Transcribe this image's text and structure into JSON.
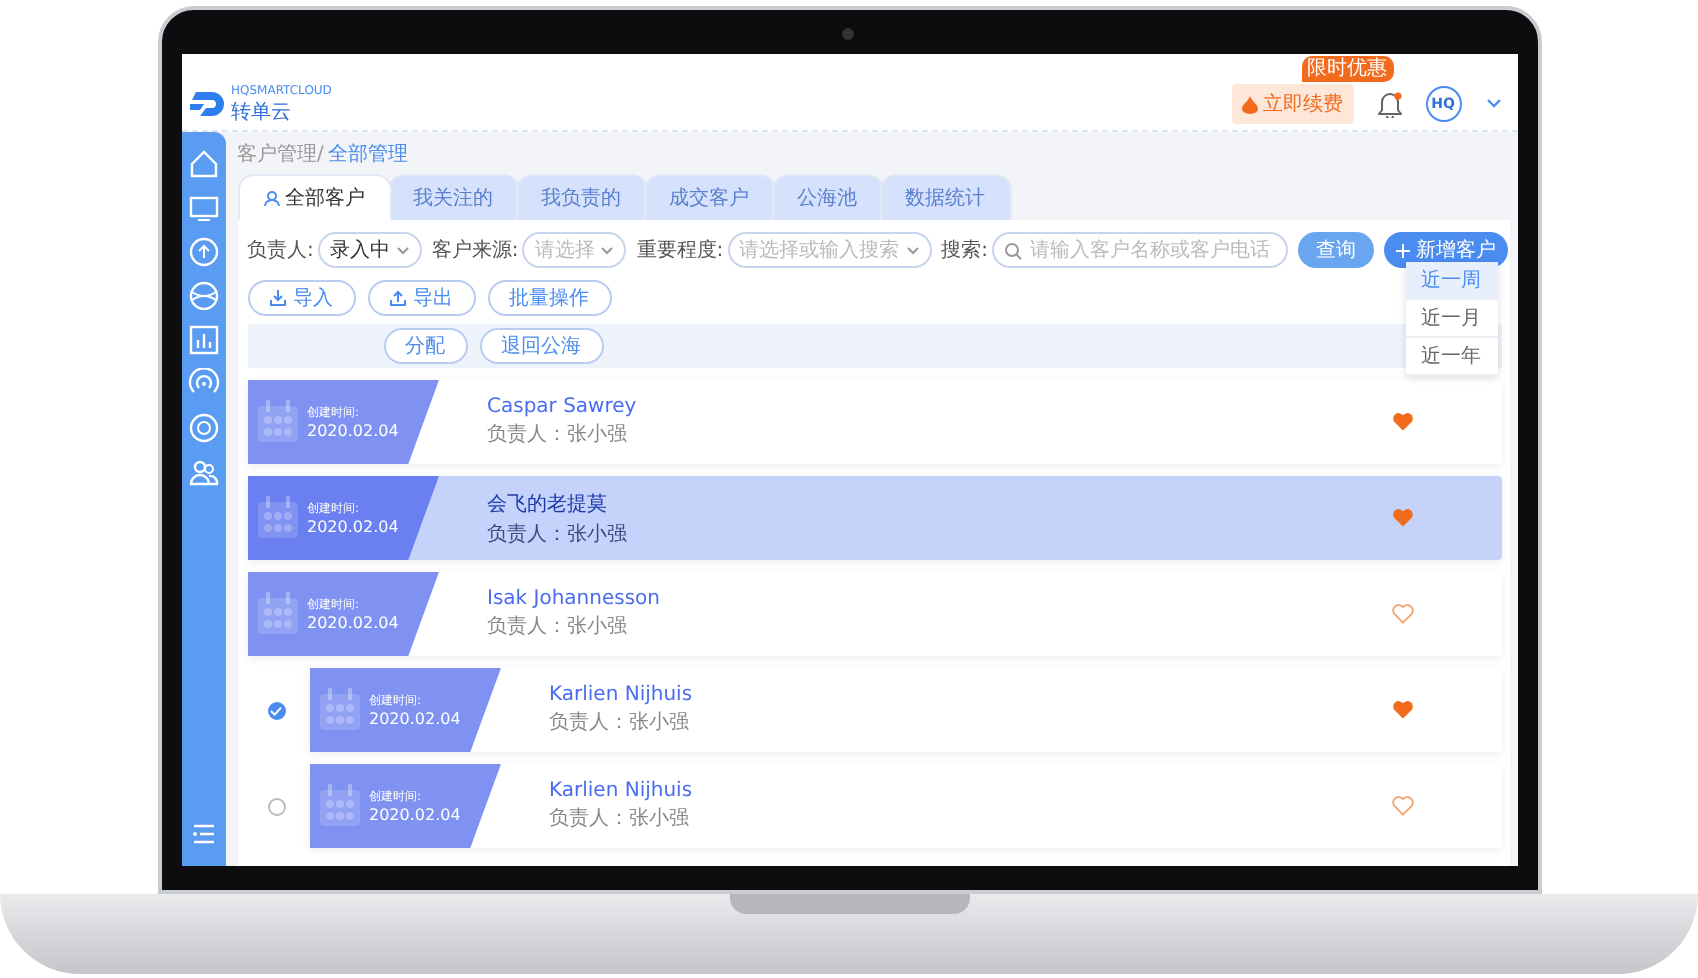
{
  "header": {
    "logo_text": "HQSMARTCLOUD",
    "brand": "转单云",
    "renew_button": "立即续费",
    "promo_badge": "限时优惠",
    "avatar": "HQ",
    "notification": true
  },
  "breadcrumb": [
    {
      "label": "客户管理/",
      "current": false
    },
    {
      "label": "全部管理",
      "current": true
    }
  ],
  "tabs": [
    {
      "label": "全部客户",
      "selected": true
    },
    {
      "label": "我关注的",
      "selected": false
    },
    {
      "label": "我负责的",
      "selected": false
    },
    {
      "label": "成交客户",
      "selected": false
    },
    {
      "label": "公海池",
      "selected": false
    },
    {
      "label": "数据统计",
      "selected": false
    }
  ],
  "filters": [
    {
      "label": "负责人:",
      "kind": "select",
      "value": "录入中"
    },
    {
      "label": "客户来源:",
      "kind": "select",
      "placeholder": "请选择"
    },
    {
      "label": "重要程度:",
      "kind": "select",
      "placeholder": "请选择或输入搜索"
    },
    {
      "label": "搜索:",
      "kind": "search",
      "placeholder": "请输入客户名称或客户电话"
    }
  ],
  "query_button": "查询",
  "add_button": "新增客户",
  "actions": [
    {
      "label": "导入",
      "kind": "download"
    },
    {
      "label": "导出",
      "kind": "upload"
    },
    {
      "label": "批量操作",
      "kind": "plain"
    }
  ],
  "bulk_actions": [
    "分配",
    "退回公海"
  ],
  "date_menu": [
    {
      "label": "近一周",
      "selected": true
    },
    {
      "label": "近一月",
      "selected": false
    },
    {
      "label": "近一年",
      "selected": false
    }
  ],
  "customers": [
    {
      "created_label": "创建时间:",
      "created": "2020.02.04",
      "name": "Caspar Sawrey",
      "owner": "负责人：张小强",
      "selected": false,
      "favorite": true
    },
    {
      "created_label": "创建时间:",
      "created": "2020.02.04",
      "name": "会飞的老提莫",
      "owner": "负责人：张小强",
      "selected": true,
      "favorite": true
    },
    {
      "created_label": "创建时间:",
      "created": "2020.02.04",
      "name": "Isak Johannesson",
      "owner": "负责人：张小强",
      "selected": false,
      "favorite": false,
      "children": [
        {
          "created_label": "创建时间:",
          "created": "2020.02.04",
          "name": "Karlien Nijhuis",
          "owner": "负责人：张小强",
          "checked": true,
          "favorite": true
        },
        {
          "created_label": "创建时间:",
          "created": "2020.02.04",
          "name": "Karlien Nijhuis",
          "owner": "负责人：张小强",
          "checked": false,
          "favorite": false
        }
      ]
    }
  ]
}
